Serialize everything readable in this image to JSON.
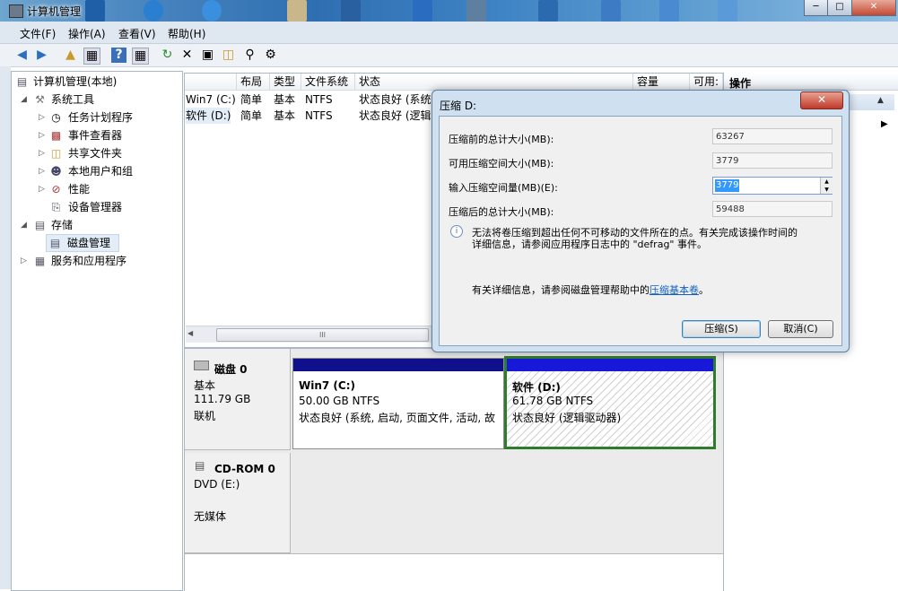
{
  "window": {
    "title": "计算机管理"
  },
  "menu": [
    "文件(F)",
    "操作(A)",
    "查看(V)",
    "帮助(H)"
  ],
  "tree": {
    "root": "计算机管理(本地)",
    "system_tools": "系统工具",
    "task_scheduler": "任务计划程序",
    "event_viewer": "事件查看器",
    "shared_folders": "共享文件夹",
    "local_users": "本地用户和组",
    "performance": "性能",
    "device_manager": "设备管理器",
    "storage": "存储",
    "disk_management": "磁盘管理",
    "services": "服务和应用程序"
  },
  "volume_table": {
    "headers": [
      "布局",
      "类型",
      "文件系统",
      "状态",
      "容量",
      "可用:"
    ],
    "rows": [
      {
        "name": "Win7 (C:)",
        "layout": "简单",
        "type": "基本",
        "fs": "NTFS",
        "status": "状态良好 (系统"
      },
      {
        "name": "软件 (D:)",
        "layout": "简单",
        "type": "基本",
        "fs": "NTFS",
        "status": "状态良好 (逻辑"
      }
    ],
    "scroll_marker": "III"
  },
  "actions": {
    "header": "操作"
  },
  "disks": [
    {
      "name": "磁盘 0",
      "kind": "基本",
      "size": "111.79 GB",
      "state": "联机",
      "partitions": [
        {
          "name": "Win7  (C:)",
          "size": "50.00 GB NTFS",
          "status": "状态良好 (系统, 启动, 页面文件, 活动, 故"
        },
        {
          "name": "软件  (D:)",
          "size": "61.78 GB NTFS",
          "status": "状态良好 (逻辑驱动器)"
        }
      ]
    },
    {
      "name": "CD-ROM 0",
      "kind": "DVD (E:)",
      "state": "无媒体"
    }
  ],
  "dialog": {
    "title": "压缩 D:",
    "total_before_label": "压缩前的总计大小(MB):",
    "total_before_value": "63267",
    "available_label": "可用压缩空间大小(MB):",
    "available_value": "3779",
    "input_label": "输入压缩空间量(MB)(E):",
    "input_value": "3779",
    "total_after_label": "压缩后的总计大小(MB):",
    "total_after_value": "59488",
    "info_line1": "无法将卷压缩到超出任何不可移动的文件所在的点。有关完成该操作时间的",
    "info_line2": "详细信息，请参阅应用程序日志中的 \"defrag\" 事件。",
    "help_prefix": "有关详细信息，请参阅磁盘管理帮助中的",
    "help_link": "压缩基本卷",
    "help_suffix": "。",
    "shrink_button": "压缩(S)",
    "cancel_button": "取消(C)"
  }
}
